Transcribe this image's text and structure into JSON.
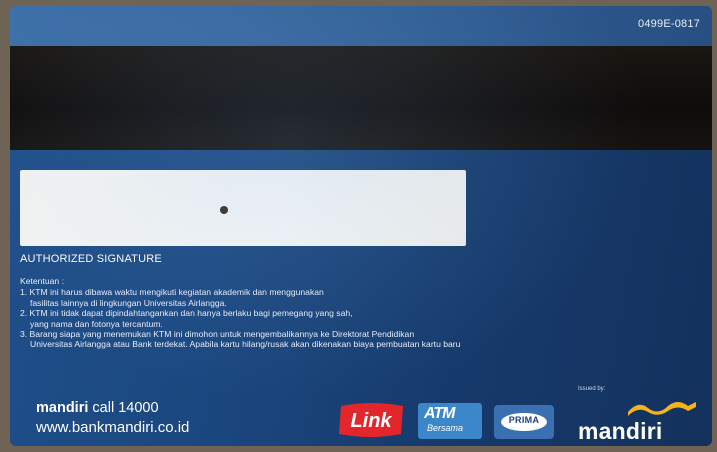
{
  "card": {
    "serial": "0499E-0817",
    "authorized_signature": "AUTHORIZED SIGNATURE",
    "terms_header": "Ketentuan :",
    "terms": [
      "1. KTM ini harus dibawa waktu mengikuti kegiatan akademik dan menggunakan",
      "fasilitas lainnya di lingkungan Universitas Airlangga.",
      "2. KTM ini tidak dapat dipindahtangankan dan hanya berlaku bagi pemegang yang sah,",
      "yang nama dan fotonya tercantum.",
      "3. Barang siapa yang menemukan KTM ini dimohon untuk mengembalikannya ke Direktorat Pendidikan",
      "Universitas Airlangga atau Bank terdekat. Apabila kartu hilang/rusak akan dikenakan biaya pembuatan kartu baru"
    ],
    "contact": {
      "brand": "mandiri",
      "call": "call 14000",
      "website": "www.bankmandiri.co.id"
    },
    "issued_by": "Issued by:",
    "logos": {
      "link": "Link",
      "atm_top": "ATM",
      "atm_bottom": "Bersama",
      "prima": "PRIMA",
      "mandiri": "mandiri"
    },
    "colors": {
      "card_blue": "#1b477f",
      "magnetic_stripe": "#100d0b",
      "link_red": "#e3262c",
      "atm_blue": "#3b87c9",
      "mandiri_yellow": "#f5b21b"
    }
  }
}
